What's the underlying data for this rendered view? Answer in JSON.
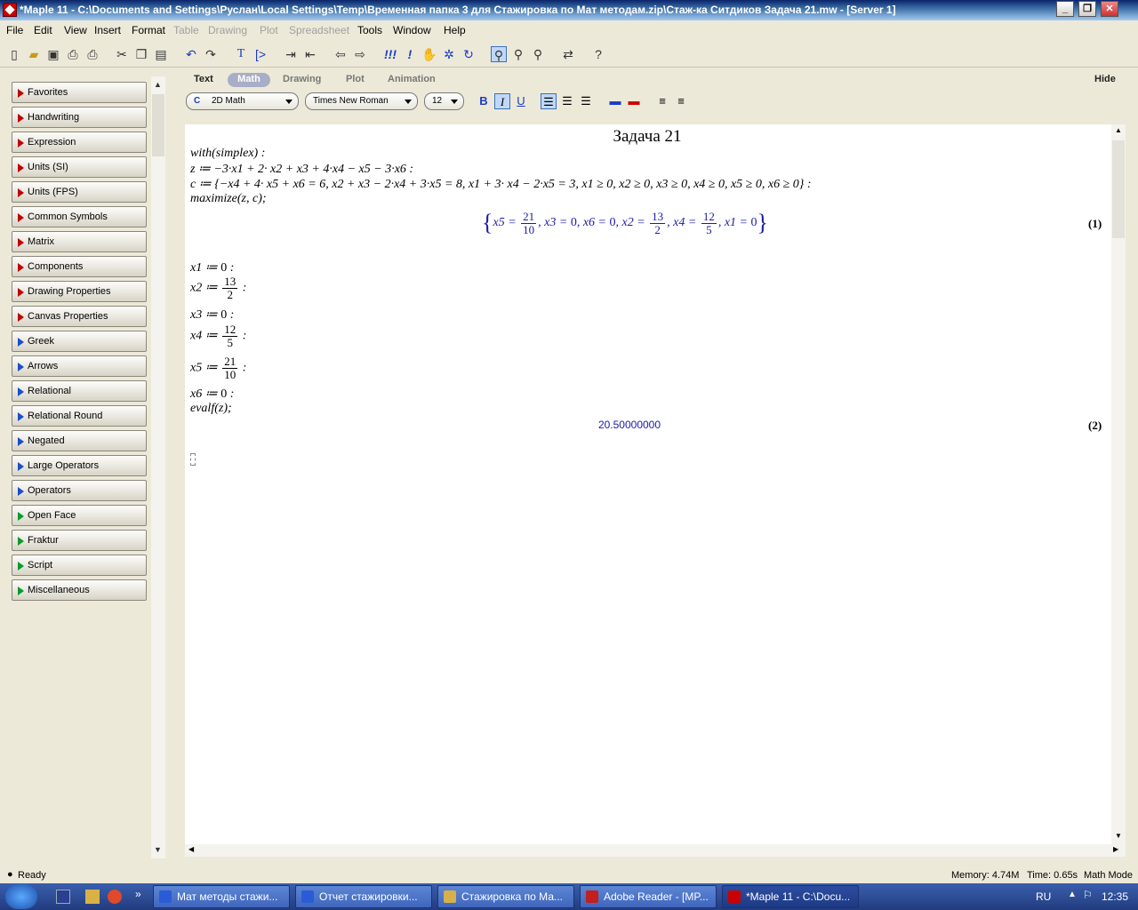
{
  "window": {
    "title": "*Maple 11 - C:\\Documents and Settings\\Руслан\\Local Settings\\Temp\\Временная папка 3 для Стажировка по Мат методам.zip\\Стаж-ка Ситдиков Задача 21.mw - [Server 1]"
  },
  "menu": [
    "File",
    "Edit",
    "View",
    "Insert",
    "Format",
    "Table",
    "Drawing",
    "Plot",
    "Spreadsheet",
    "Tools",
    "Window",
    "Help"
  ],
  "toolbar": {
    "icons": [
      "new-icon",
      "open-icon",
      "save-icon",
      "print-icon",
      "print-preview-icon",
      "cut-icon",
      "copy-icon",
      "paste-icon",
      "undo-icon",
      "redo-icon",
      "text-icon",
      "math-prompt-icon",
      "indent-icon",
      "outdent-icon",
      "back-icon",
      "forward-icon",
      "execute-all-icon",
      "execute-icon",
      "stop-icon",
      "debug-icon",
      "restart-icon",
      "zoom-100-icon",
      "zoom-150-icon",
      "zoom-200-icon",
      "toggle-input-icon",
      "help-icon"
    ]
  },
  "palettes": [
    "Favorites",
    "Handwriting",
    "Expression",
    "Units (SI)",
    "Units (FPS)",
    "Common Symbols",
    "Matrix",
    "Components",
    "Drawing Properties",
    "Canvas Properties",
    "Greek",
    "Arrows",
    "Relational",
    "Relational Round",
    "Negated",
    "Large Operators",
    "Operators",
    "Open Face",
    "Fraktur",
    "Script",
    "Miscellaneous"
  ],
  "context": {
    "tabs": [
      "Text",
      "Math",
      "Drawing",
      "Plot",
      "Animation"
    ],
    "active_tab": "Math",
    "hide_label": "Hide",
    "mode": "2D Math",
    "mode_prefix": "C",
    "font": "Times New Roman",
    "size": "12",
    "bold": "B",
    "italic": "I",
    "underline": "U"
  },
  "document": {
    "heading": "Задача 21",
    "lines": [
      "with(simplex) :",
      "z ≔ −3·x1 + 2· x2 + x3 + 4·x4 − x5 − 3·x6 :",
      "c ≔ {−x4 + 4· x5 + x6 = 6, x2 + x3 − 2·x4 + 3·x5 = 8, x1 + 3· x4 − 2·x5 = 3, x1 ≥ 0, x2 ≥ 0, x3 ≥ 0, x4 ≥ 0, x5 ≥ 0, x6 ≥ 0} :",
      "maximize(z, c);"
    ],
    "output1": {
      "x5": [
        "21",
        "10"
      ],
      "x3": "0",
      "x6": "0",
      "x2": [
        "13",
        "2"
      ],
      "x4": [
        "12",
        "5"
      ],
      "x1": "0",
      "label": "(1)"
    },
    "assignments": [
      {
        "var": "x1",
        "value": "0"
      },
      {
        "var": "x2",
        "num": "13",
        "den": "2"
      },
      {
        "var": "x3",
        "value": "0"
      },
      {
        "var": "x4",
        "num": "12",
        "den": "5"
      },
      {
        "var": "x5",
        "num": "21",
        "den": "10"
      },
      {
        "var": "x6",
        "value": "0"
      }
    ],
    "eval_line": "evalf(z);",
    "output2": {
      "value": "20.50000000",
      "label": "(2)"
    }
  },
  "status": {
    "ready": "Ready",
    "memory": "Memory: 4.74M",
    "time": "Time: 0.65s",
    "mode": "Math Mode"
  },
  "taskbar": {
    "tasks": [
      "Мат методы стажи...",
      "Отчет стажировки...",
      "Стажировка по Ма...",
      "Adobe Reader - [MP...",
      "*Maple 11 - C:\\Docu..."
    ],
    "lang": "RU",
    "clock": "12:35"
  },
  "colors": {
    "title_bar": "#0a246a",
    "output_text": "#1a1aaa",
    "palette_arrow": "#c00000"
  }
}
